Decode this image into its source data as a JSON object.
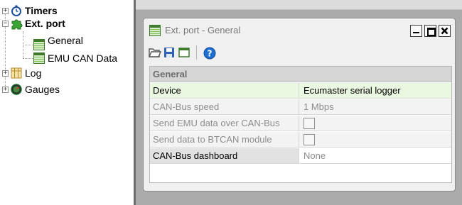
{
  "tree": {
    "items": [
      {
        "label": "Timers",
        "icon": "stopwatch-icon"
      },
      {
        "label": "Ext. port",
        "icon": "puzzle-icon"
      },
      {
        "label": "General",
        "icon": "table-icon"
      },
      {
        "label": "EMU CAN Data",
        "icon": "table-icon"
      },
      {
        "label": "Log",
        "icon": "log-icon"
      },
      {
        "label": "Gauges",
        "icon": "gauge-icon"
      }
    ]
  },
  "window": {
    "title": "Ext. port - General",
    "buttons": {
      "minimize": "minimize-icon",
      "maximize": "maximize-icon",
      "close": "close-icon"
    }
  },
  "toolbar": {
    "icons": [
      "open-folder-icon",
      "save-icon",
      "window-icon",
      "help-icon"
    ]
  },
  "grid": {
    "category": "General",
    "rows": [
      {
        "name": "Device",
        "value": "Ecumaster serial logger"
      },
      {
        "name": "CAN-Bus speed",
        "value": "1 Mbps"
      },
      {
        "name": "Send EMU data over CAN-Bus",
        "value": ""
      },
      {
        "name": "Send data to BTCAN module",
        "value": ""
      },
      {
        "name": "CAN-Bus dashboard",
        "value": "None"
      }
    ]
  },
  "colors": {
    "selected_row": "#eaf8e2",
    "category_bg": "#d5d5d5",
    "mdi_bg": "#ababab",
    "help_blue": "#1f6fd1"
  }
}
